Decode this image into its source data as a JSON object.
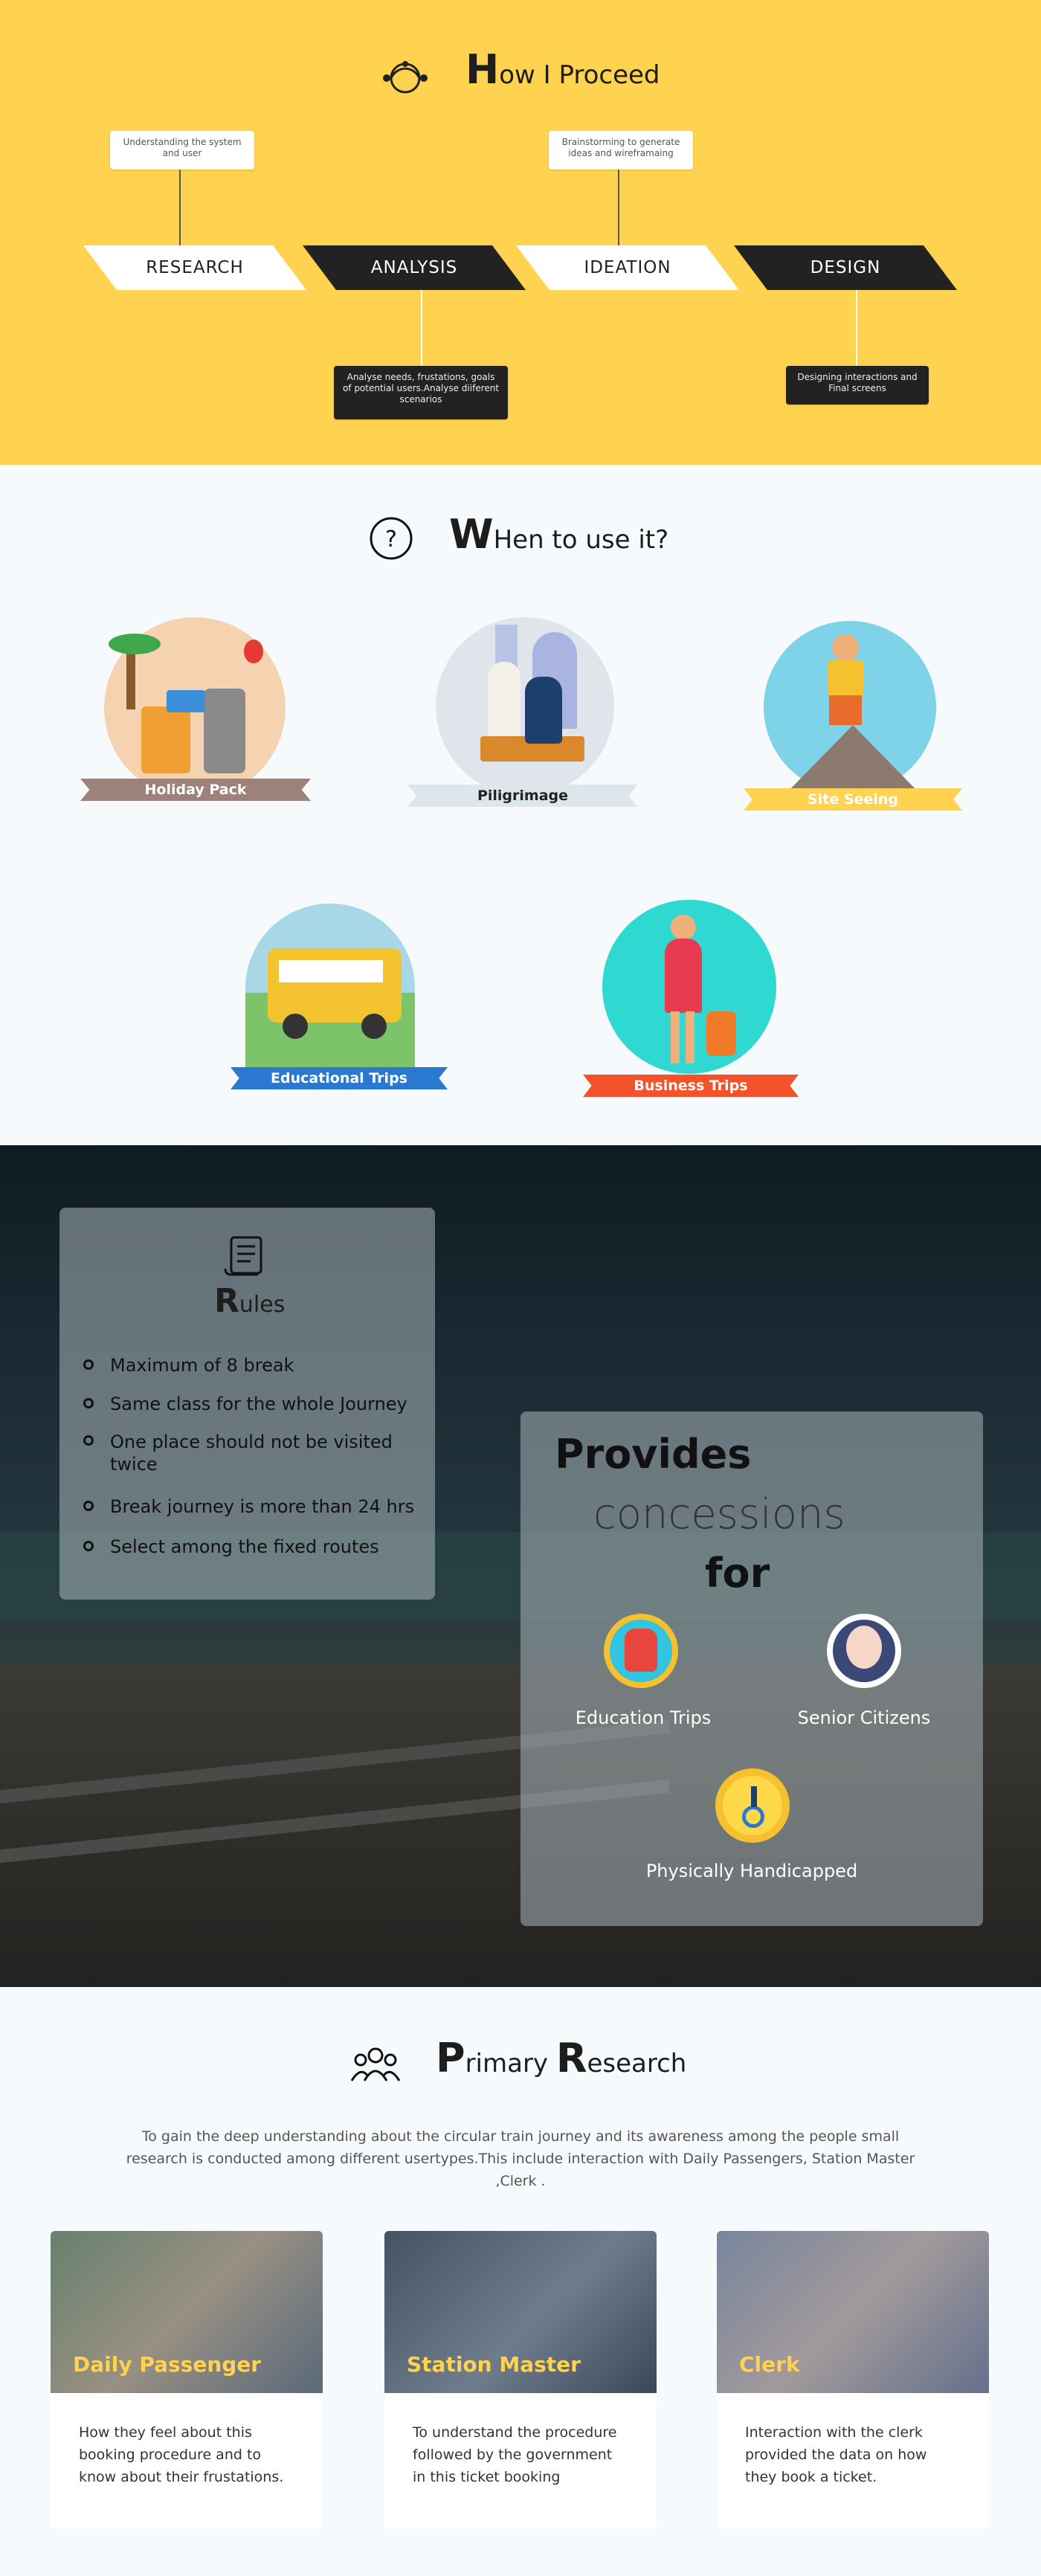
{
  "proceed": {
    "title_first": "H",
    "title_rest": "ow I Proceed",
    "steps": [
      "RESEARCH",
      "ANALYSIS",
      "IDEATION",
      "DESIGN"
    ],
    "callouts": {
      "research": "Understanding the system and user",
      "ideation": "Brainstorming to generate ideas and wireframaing",
      "analysis": "Analyse needs, frustations, goals of potential users.Analyse diiferent scenarios",
      "design": "Designing interactions and Final screens"
    }
  },
  "when": {
    "title_first": "W",
    "title_rest": "Hen to use it?",
    "items": [
      "Holiday Pack",
      "Piligrimage",
      "Site Seeing",
      "Educational Trips",
      "Business Trips"
    ]
  },
  "rules": {
    "title_first": "R",
    "title_rest": "ules",
    "items": [
      "Maximum of 8 break",
      "Same class for the whole Journey",
      "One place should not be visited twice",
      "Break journey is more than 24 hrs",
      "Select among the fixed routes"
    ]
  },
  "concessions": {
    "line1": "Provides",
    "line2": "concessions",
    "line3": "for",
    "items": [
      "Education Trips",
      "Senior Citizens",
      "Physically Handicapped"
    ]
  },
  "research": {
    "title_first1": "P",
    "title_rest1": "rimary ",
    "title_first2": "R",
    "title_rest2": "esearch",
    "intro": "To gain the deep understanding about the circular train journey and its awareness among the people small research is conducted among different usertypes.This include interaction with Daily Passengers, Station Master ,Clerk .",
    "cards": [
      {
        "title": "Daily Passenger",
        "text": "How they feel about this booking procedure and to know about their frustations."
      },
      {
        "title": "Station Master",
        "text": "To understand the procedure followed by the government in this ticket booking"
      },
      {
        "title": "Clerk",
        "text": "Interaction with the clerk provided the data on how they book a ticket."
      }
    ]
  },
  "colors": {
    "accent": "#ffd24f",
    "dark": "#222222",
    "page": "#f7fafc"
  }
}
